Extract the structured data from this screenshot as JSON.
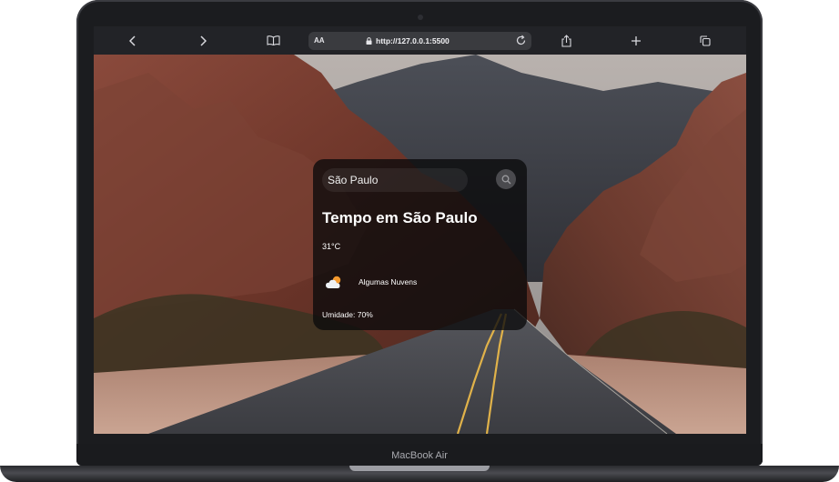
{
  "device": {
    "label": "MacBook Air"
  },
  "browser": {
    "text_size_label": "AA",
    "url": "http://127.0.0.1:5500",
    "icons": [
      "back-icon",
      "forward-icon",
      "book-icon",
      "lock-icon",
      "reload-icon",
      "share-icon",
      "plus-icon",
      "tabs-icon"
    ]
  },
  "weather": {
    "search_value": "São Paulo",
    "title": "Tempo em São Paulo",
    "temperature": "31°C",
    "description": "Algumas Nuvens",
    "humidity": "Umidade: 70%",
    "icon": "cloud-sun-icon"
  },
  "colors": {
    "card_bg": "#0a0a0c",
    "toolbar_bg": "#222327",
    "sun": "#f59a2e"
  }
}
